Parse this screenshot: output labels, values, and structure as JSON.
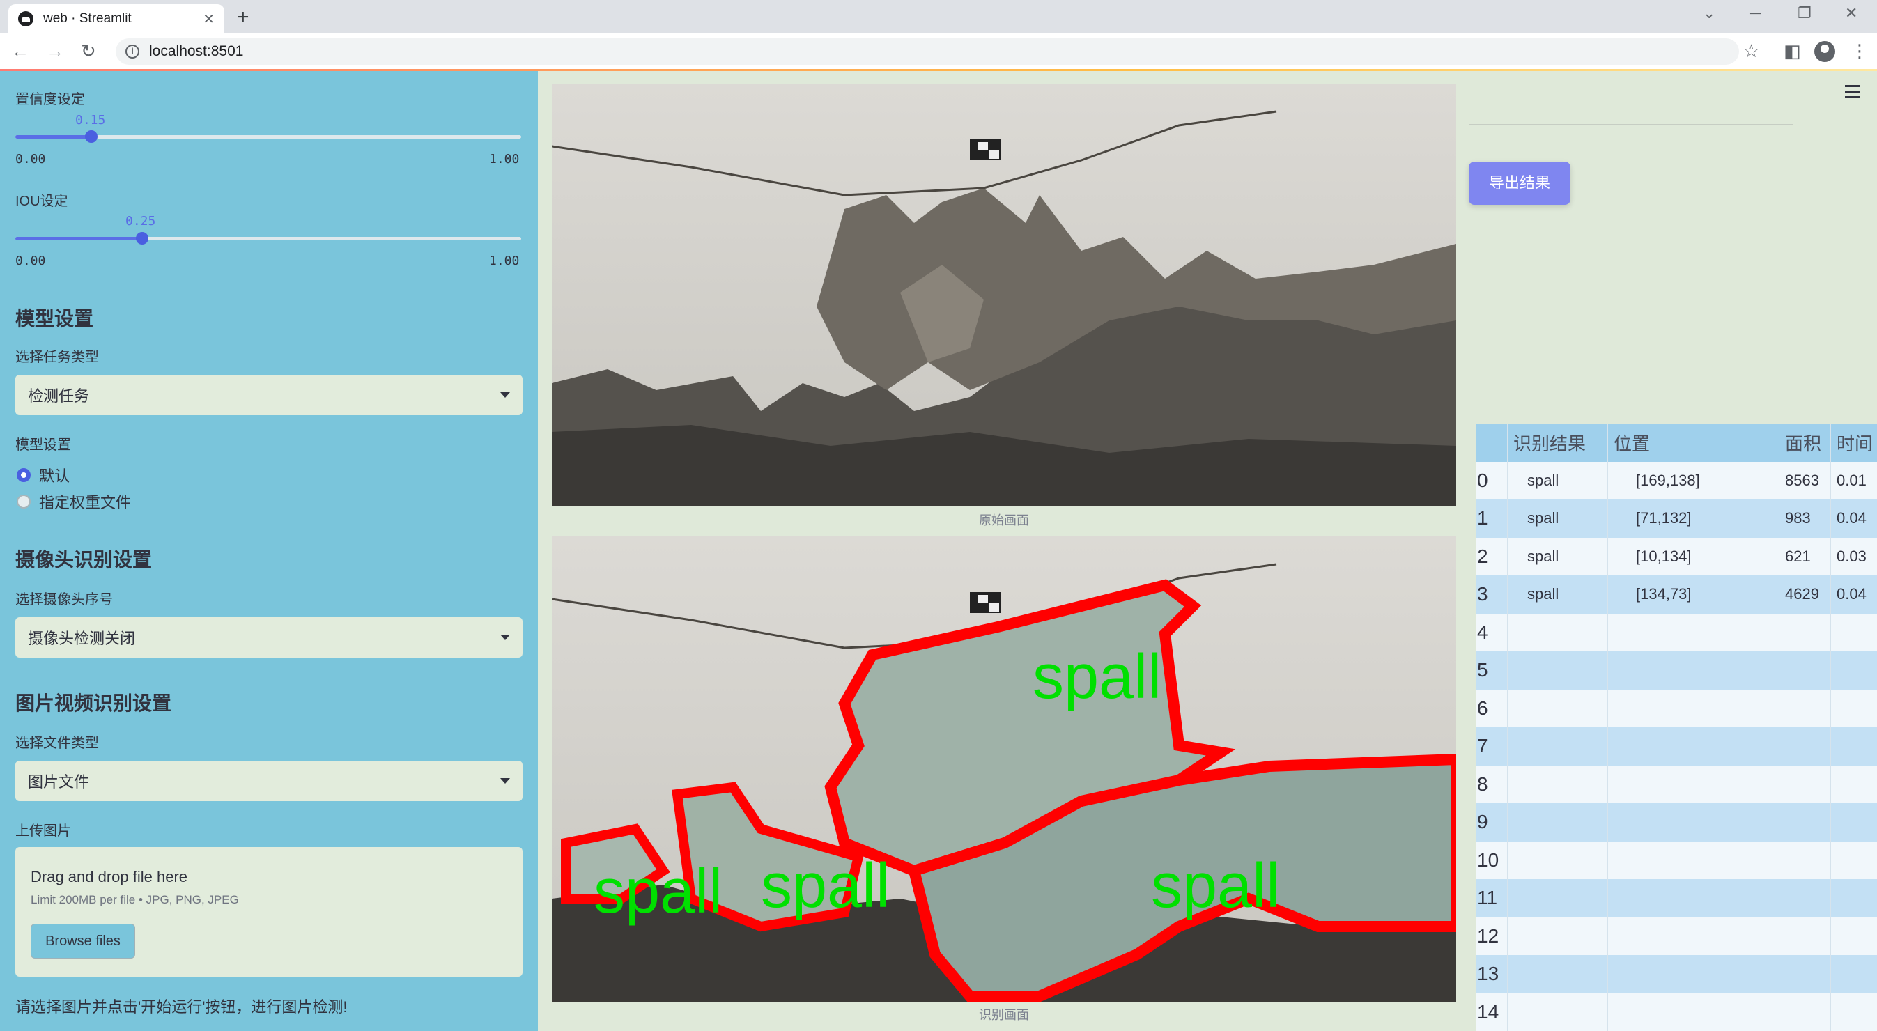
{
  "browser": {
    "tab_title": "web · Streamlit",
    "url": "localhost:8501"
  },
  "sidebar": {
    "conf_label": "置信度设定",
    "conf_value": "0.15",
    "conf_min": "0.00",
    "conf_max": "1.00",
    "conf_fraction": 0.15,
    "iou_label": "IOU设定",
    "iou_value": "0.25",
    "iou_min": "0.00",
    "iou_max": "1.00",
    "iou_fraction": 0.25,
    "model_header": "模型设置",
    "task_label": "选择任务类型",
    "task_value": "检测任务",
    "model_label": "模型设置",
    "radio_default": "默认",
    "radio_custom": "指定权重文件",
    "camera_header": "摄像头识别设置",
    "camera_label": "选择摄像头序号",
    "camera_value": "摄像头检测关闭",
    "media_header": "图片视频识别设置",
    "filetype_label": "选择文件类型",
    "filetype_value": "图片文件",
    "upload_label": "上传图片",
    "upload_title": "Drag and drop file here",
    "upload_limit": "Limit 200MB per file • JPG, PNG, JPEG",
    "browse_label": "Browse files",
    "hint": "请选择图片并点击'开始运行'按钮，进行图片检测!"
  },
  "main": {
    "original_caption": "原始画面",
    "result_caption": "识别画面",
    "detection_label": "spall",
    "export_label": "导出结果"
  },
  "table": {
    "headers": [
      "识别结果",
      "位置",
      "面积",
      "时间"
    ],
    "rows": [
      {
        "idx": "0",
        "label": "spall",
        "pos": "[169,138]",
        "area": "8563",
        "time": "0.01"
      },
      {
        "idx": "1",
        "label": "spall",
        "pos": "[71,132]",
        "area": "983",
        "time": "0.04"
      },
      {
        "idx": "2",
        "label": "spall",
        "pos": "[10,134]",
        "area": "621",
        "time": "0.03"
      },
      {
        "idx": "3",
        "label": "spall",
        "pos": "[134,73]",
        "area": "4629",
        "time": "0.04"
      },
      {
        "idx": "4",
        "label": "",
        "pos": "",
        "area": "",
        "time": ""
      },
      {
        "idx": "5",
        "label": "",
        "pos": "",
        "area": "",
        "time": ""
      },
      {
        "idx": "6",
        "label": "",
        "pos": "",
        "area": "",
        "time": ""
      },
      {
        "idx": "7",
        "label": "",
        "pos": "",
        "area": "",
        "time": ""
      },
      {
        "idx": "8",
        "label": "",
        "pos": "",
        "area": "",
        "time": ""
      },
      {
        "idx": "9",
        "label": "",
        "pos": "",
        "area": "",
        "time": ""
      },
      {
        "idx": "10",
        "label": "",
        "pos": "",
        "area": "",
        "time": ""
      },
      {
        "idx": "11",
        "label": "",
        "pos": "",
        "area": "",
        "time": ""
      },
      {
        "idx": "12",
        "label": "",
        "pos": "",
        "area": "",
        "time": ""
      },
      {
        "idx": "13",
        "label": "",
        "pos": "",
        "area": "",
        "time": ""
      },
      {
        "idx": "14",
        "label": "",
        "pos": "",
        "area": "",
        "time": ""
      }
    ]
  },
  "colors": {
    "sidebar": "#7ac5db",
    "accent": "#4a5fe0",
    "detection_box": "#ff0000",
    "detection_text": "#00e000",
    "export_button": "#7f86f0"
  }
}
